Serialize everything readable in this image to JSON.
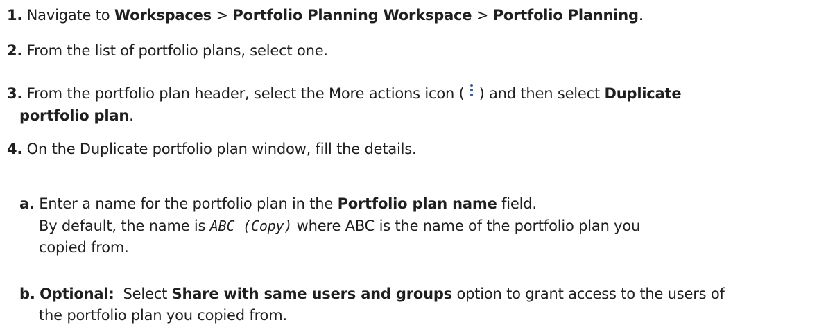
{
  "steps": [
    {
      "num": "1.",
      "t1": " Navigate to ",
      "b1": "Workspaces",
      "t2": " > ",
      "b2": "Portfolio Planning Workspace",
      "t3": " > ",
      "b3": "Portfolio Planning",
      "t4": "."
    },
    {
      "num": "2.",
      "text": " From the list of portfolio plans, select one."
    },
    {
      "num": "3.",
      "t1": " From the portfolio plan header, select the More actions icon ( ",
      "icon": "more-actions-vertical-dots-icon",
      "t2": " ) and then select ",
      "b1": "Duplicate",
      "b2": "portfolio plan",
      "t3": "."
    },
    {
      "num": "4.",
      "text": " On the Duplicate portfolio plan window, fill the details."
    }
  ],
  "substeps": [
    {
      "num": "a.",
      "t1": " Enter a name for the portfolio plan in the ",
      "b1": "Portfolio plan name",
      "t2": " field.",
      "l2a": "By default, the name is ",
      "code": "ABC (Copy)",
      "l2b": " where ABC is the name of the portfolio plan you",
      "l3": "copied from."
    },
    {
      "num": "b.",
      "b0": "Optional:",
      "t1": "  Select ",
      "b1": "Share with same users and groups",
      "t2": " option to grant access to the users of",
      "l2": "the portfolio plan you copied from."
    }
  ],
  "colors": {
    "text": "#1f1f1f",
    "icon": "#2b57c9"
  }
}
